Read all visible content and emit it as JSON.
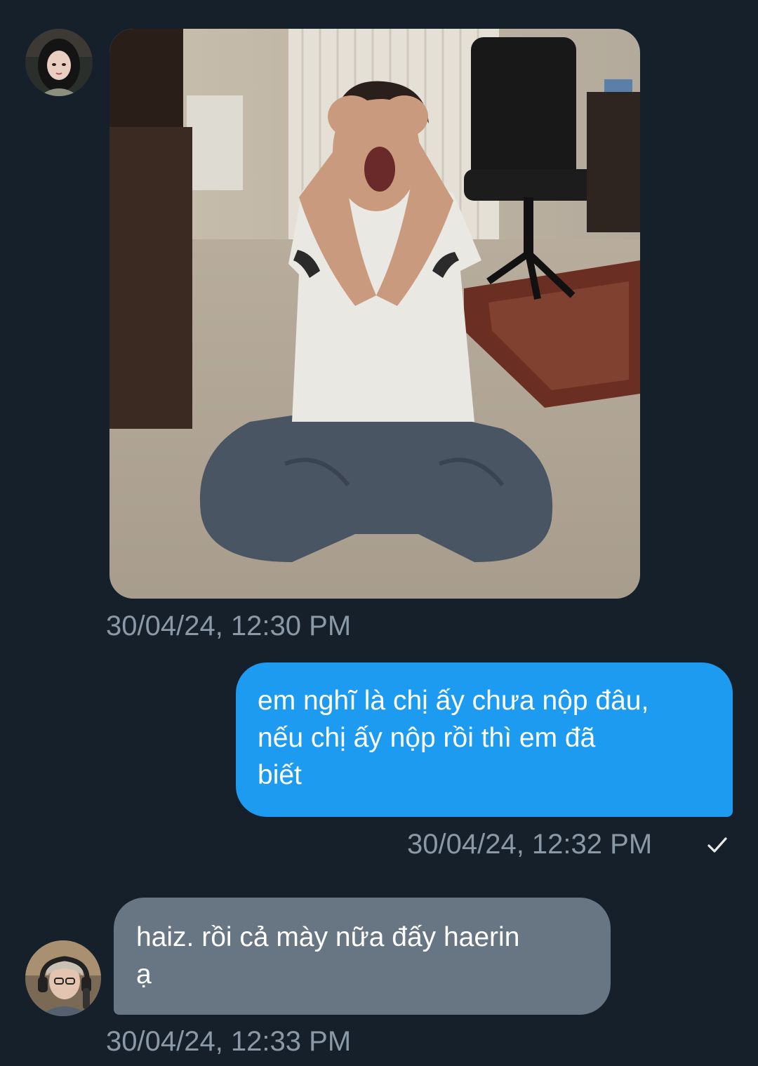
{
  "conversation": {
    "messages": [
      {
        "direction": "received",
        "type": "image",
        "image_description": "person kneeling on carpet screaming with hands on head",
        "timestamp": "30/04/24, 12:30 PM",
        "avatar": "avatar-girl-icon"
      },
      {
        "direction": "sent",
        "type": "text",
        "lines": [
          "em nghĩ là chị ấy chưa nộp đâu,",
          "nếu chị ấy nộp rồi thì em đã",
          "biết"
        ],
        "timestamp": "30/04/24, 12:32 PM",
        "status_icon": "checkmark-icon"
      },
      {
        "direction": "received",
        "type": "text",
        "lines": [
          "haiz. rồi cả mày nữa đấy haerin",
          "ạ"
        ],
        "timestamp": "30/04/24, 12:33 PM",
        "avatar": "avatar-girl-headphones-icon"
      }
    ]
  },
  "colors": {
    "background": "#15202b",
    "sent_bubble": "#1d9bf0",
    "received_bubble": "#687683",
    "timestamp": "#8b98a5",
    "text": "#ffffff"
  }
}
